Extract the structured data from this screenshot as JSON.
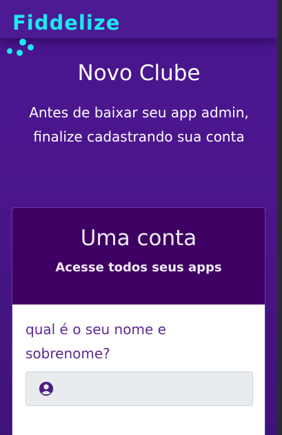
{
  "header": {
    "brand": "Fiddelize",
    "brand_color": "#1ce8f0"
  },
  "hero": {
    "title": "Novo Clube",
    "subtitle": "Antes de baixar seu app admin, finalize cadastrando sua conta"
  },
  "card": {
    "title": "Uma conta",
    "subtitle": "Acesse todos seus apps",
    "header_color": "#3e0062"
  },
  "form": {
    "name_label": "qual é o seu nome e sobrenome?",
    "name_value": "",
    "name_icon": "user-circle-icon"
  },
  "colors": {
    "background": "#4a168a",
    "label": "#5b2a8f",
    "input_bg": "#e9ecef"
  }
}
